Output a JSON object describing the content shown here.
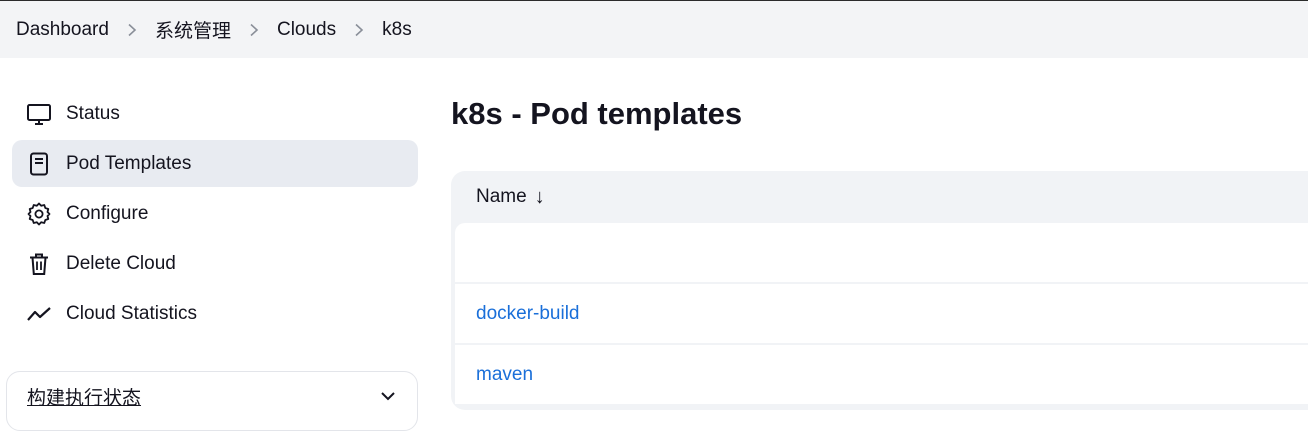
{
  "breadcrumb": {
    "items": [
      "Dashboard",
      "系统管理",
      "Clouds",
      "k8s"
    ]
  },
  "sidebar": {
    "items": [
      {
        "label": "Status",
        "icon": "monitor-icon"
      },
      {
        "label": "Pod Templates",
        "icon": "document-icon",
        "active": true
      },
      {
        "label": "Configure",
        "icon": "gear-icon"
      },
      {
        "label": "Delete Cloud",
        "icon": "trash-icon"
      },
      {
        "label": "Cloud Statistics",
        "icon": "trend-line-icon"
      }
    ]
  },
  "build_status": {
    "label": "构建执行状态"
  },
  "main": {
    "title": "k8s - Pod templates",
    "table": {
      "header": "Name",
      "sort_indicator": "↓",
      "rows": [
        "",
        "docker-build",
        "maven"
      ]
    }
  },
  "colors": {
    "link": "#1a6fd9",
    "active_bg": "#e8ebf1",
    "topbar_bg": "#f3f4f6"
  }
}
